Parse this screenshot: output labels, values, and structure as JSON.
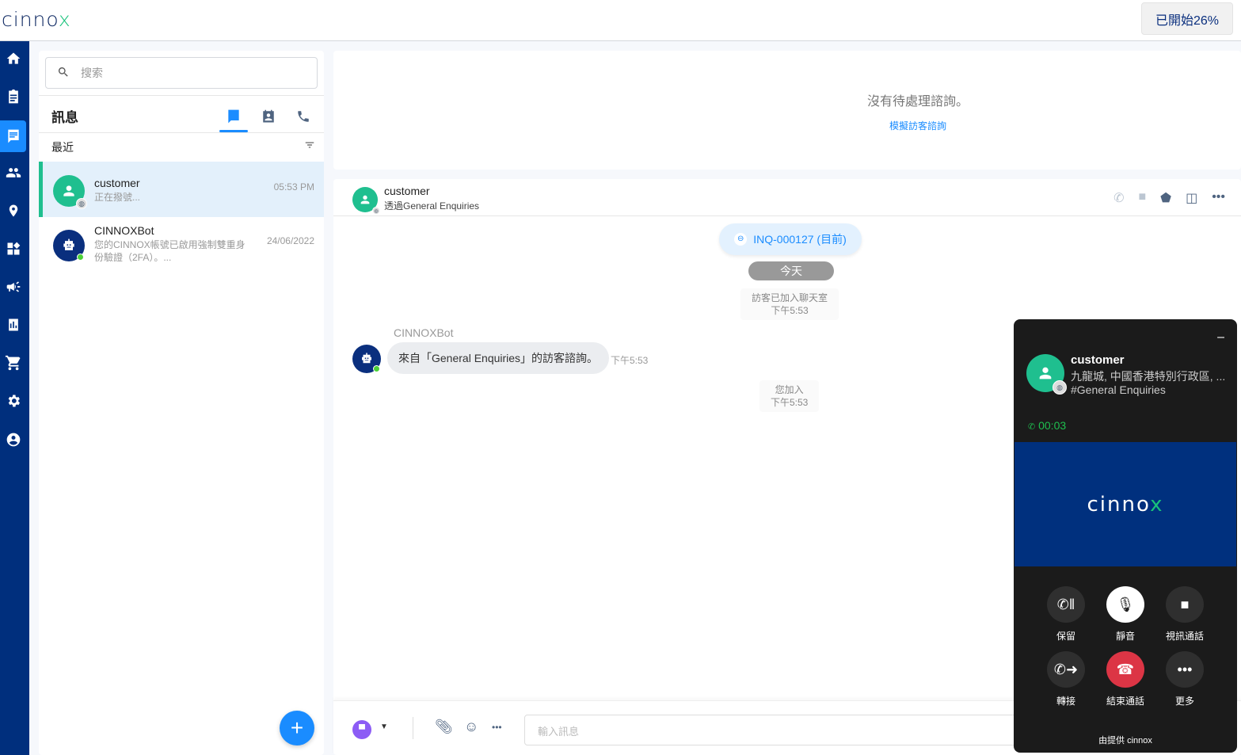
{
  "topbar": {
    "logo": "cinnox",
    "trial": "已開始26%"
  },
  "nav": [
    "home-icon",
    "clipboard-icon",
    "chat-icon",
    "contacts-icon",
    "location-icon",
    "widgets-icon",
    "campaign-icon",
    "report-icon",
    "cart-icon",
    "settings-icon",
    "account-icon"
  ],
  "left": {
    "search_placeholder": "搜索",
    "title": "訊息",
    "recent": "最近",
    "conversations": [
      {
        "name": "customer",
        "preview": "正在撥號...",
        "time": "05:53 PM"
      },
      {
        "name": "CINNOXBot",
        "preview": "您的CINNOX帳號已啟用強制雙重身份驗證（2FA）。...",
        "time": "24/06/2022"
      }
    ],
    "fab": "+"
  },
  "pending": {
    "message": "沒有待處理諮詢。",
    "link": "模擬訪客諮詢"
  },
  "chat": {
    "name": "customer",
    "via": "透過General Enquiries",
    "inquiry": "INQ-000127 (目前)",
    "today": "今天",
    "sys1": {
      "text": "訪客已加入聊天室",
      "time": "下午5:53"
    },
    "bot_name": "CINNOXBot",
    "bot_message": "來自「General Enquiries」的訪客諮詢。",
    "bot_time": "下午5:53",
    "sys2": {
      "text": "您加入",
      "time": "下午5:53"
    },
    "input_placeholder": "輸入訊息"
  },
  "call": {
    "name": "customer",
    "location": "九龍城, 中國香港特別行政區, ...",
    "group": "#General Enquiries",
    "timer": "00:03",
    "video_logo": "cinnox",
    "buttons": [
      {
        "label": "保留",
        "icon": "hold-icon"
      },
      {
        "label": "靜音",
        "icon": "mic-icon"
      },
      {
        "label": "視訊通話",
        "icon": "video-icon"
      },
      {
        "label": "轉接",
        "icon": "transfer-icon"
      },
      {
        "label": "結束通話",
        "icon": "hangup-icon"
      },
      {
        "label": "更多",
        "icon": "more-icon"
      }
    ],
    "powered": "由提供 cinnox"
  },
  "colors": {
    "nav": "#002f7d",
    "accent": "#1a8cff",
    "green": "#1fbf8f",
    "hangup": "#dc3545"
  }
}
